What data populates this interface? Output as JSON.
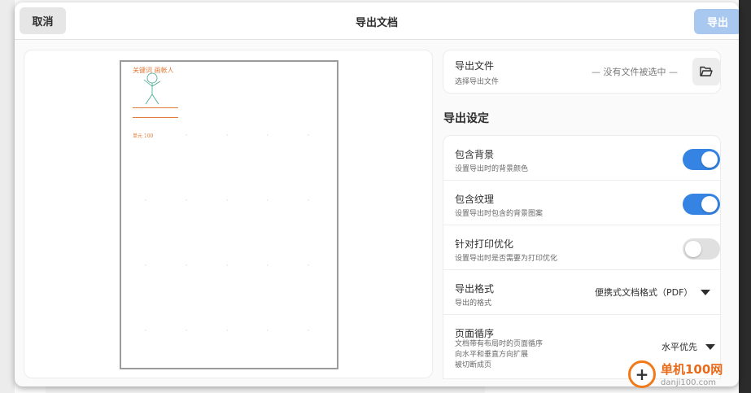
{
  "header": {
    "cancel_label": "取消",
    "title": "导出文档",
    "export_label": "导出"
  },
  "preview": {
    "handwriting": "关键词 画帐人",
    "label_text": "单元 100"
  },
  "export_file": {
    "title": "导出文件",
    "subtitle": "选择导出文件",
    "value": "— 没有文件被选中 —",
    "folder_icon": "folder-open-icon"
  },
  "settings": {
    "section_title": "导出设定",
    "rows": [
      {
        "title": "包含背景",
        "subtitle": "设置导出时的背景颜色",
        "toggle": true
      },
      {
        "title": "包含纹理",
        "subtitle": "设置导出时包含的背景图案",
        "toggle": true
      },
      {
        "title": "针对打印优化",
        "subtitle": "设置导出时是否需要为打印优化",
        "toggle": false
      },
      {
        "title": "导出格式",
        "subtitle": "导出的格式",
        "value": "便携式文档格式（PDF）"
      },
      {
        "title": "页面循序",
        "subtitle_lines": [
          "文档带有布局时的页面循序",
          "向水平和垂直方向扩展",
          "被切断成页"
        ],
        "value": "水平优先"
      }
    ]
  },
  "watermark": {
    "name": "单机100网",
    "url": "danji100.com"
  },
  "colors": {
    "accent": "#3584e4",
    "export_button": "#a8c8f0",
    "sketch": "#e07a3a"
  }
}
